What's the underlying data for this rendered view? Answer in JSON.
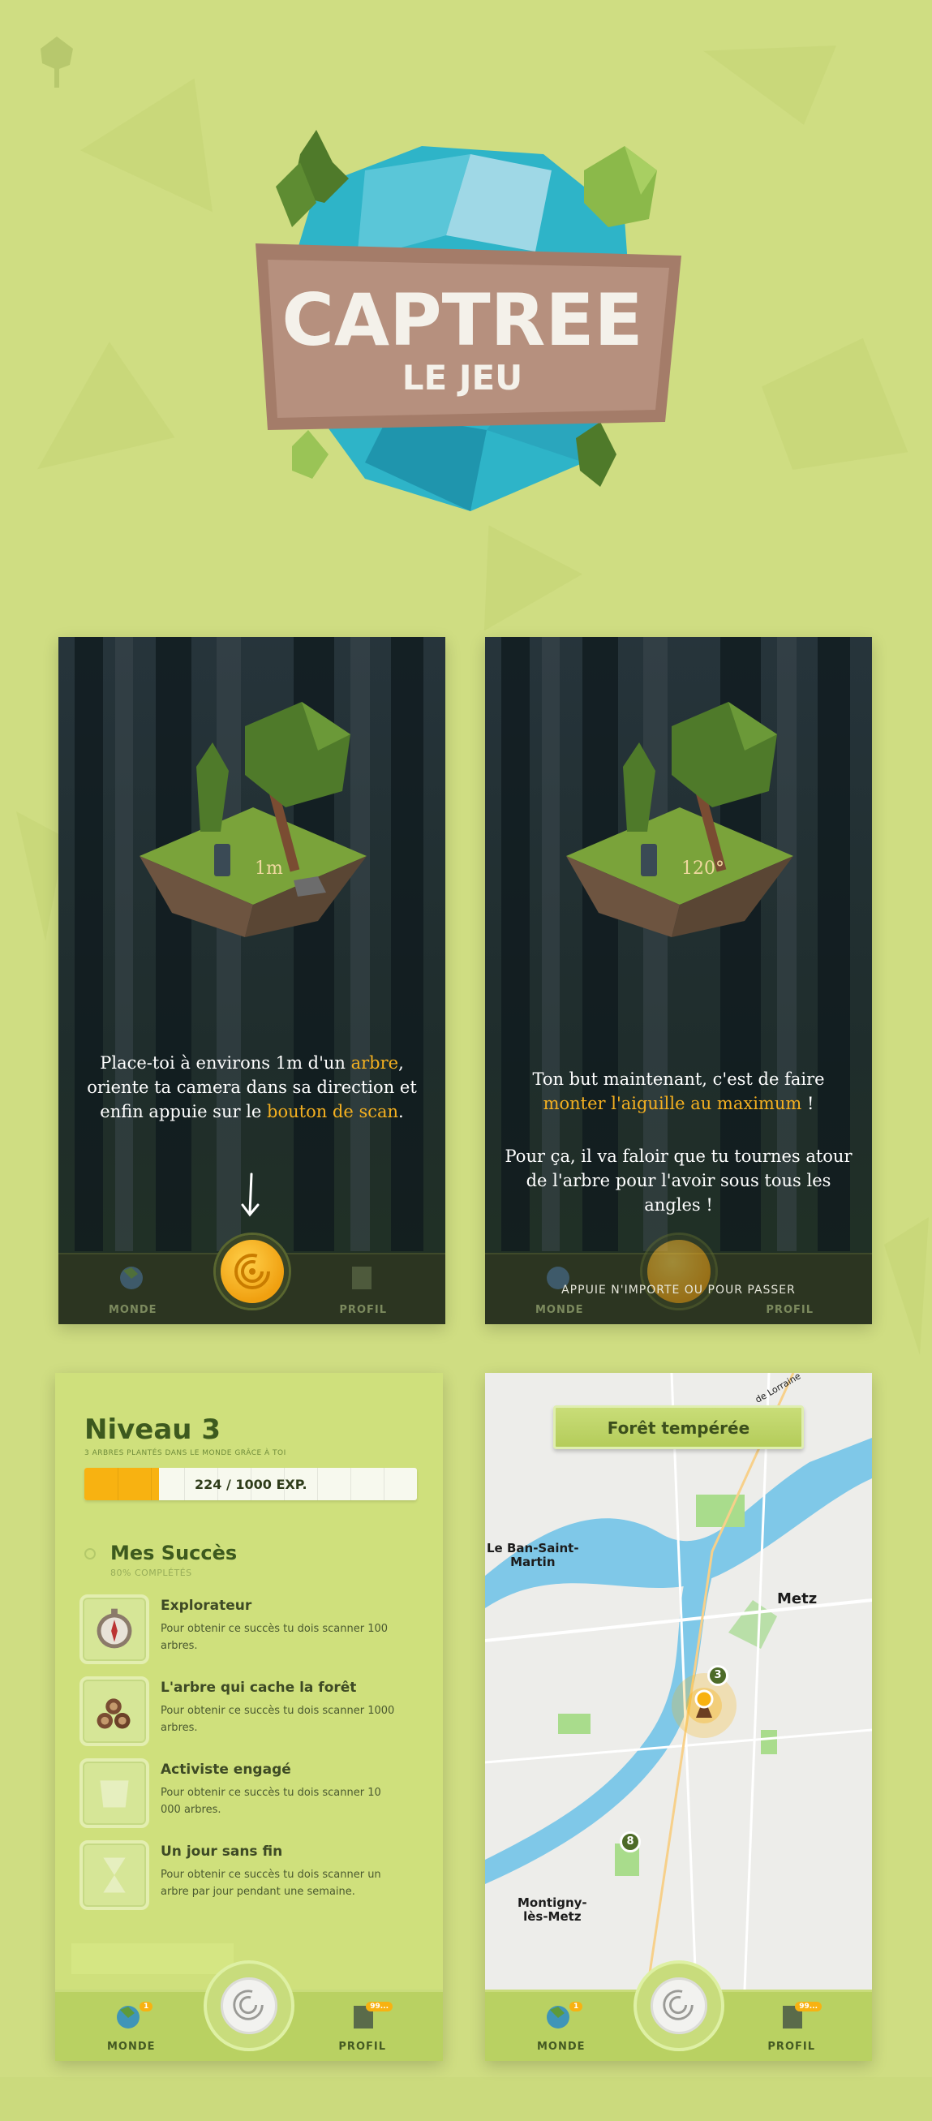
{
  "logo": {
    "title": "CAPTREE",
    "subtitle": "LE JEU"
  },
  "tutorial_1": {
    "text_before": "Place-toi à environs 1m d'un ",
    "text_highlight_1": "arbre",
    "text_middle": ", oriente ta camera dans sa direction et enfin appuie sur le ",
    "text_highlight_2": "bouton de scan",
    "text_end": ".",
    "sign_label": "1m",
    "nav_left": "MONDE",
    "nav_right": "PROFIL"
  },
  "tutorial_2": {
    "text_before": "Ton but maintenant, c'est de faire ",
    "text_highlight": "monter l'aiguille au maximum",
    "text_end": " !",
    "text_second": "Pour ça, il va faloir que tu tournes atour de l'arbre pour l'avoir sous tous les angles !",
    "sign_label": "120°",
    "skip_text": "APPUIE N'IMPORTE OU POUR PASSER",
    "nav_left": "MONDE",
    "nav_right": "PROFIL"
  },
  "profile": {
    "level_title": "Niveau 3",
    "level_subtitle": "3 ARBRES PLANTÉS DANS LE MONDE GRÂCE À TOI",
    "xp_text": "224 / 1000 EXP.",
    "xp_progress": 0.224,
    "achievements_title": "Mes Succès",
    "achievements_progress": "80% COMPLÉTÉS",
    "achievements": [
      {
        "title": "Explorateur",
        "desc": "Pour obtenir ce succès tu dois scanner 100 arbres.",
        "icon": "compass-icon",
        "unlocked": true
      },
      {
        "title": "L'arbre qui cache la forêt",
        "desc": "Pour obtenir ce succès tu dois scanner 1000 arbres.",
        "icon": "logs-icon",
        "unlocked": true
      },
      {
        "title": "Activiste engagé",
        "desc": "Pour obtenir ce succès tu dois scanner 10 000 arbres.",
        "icon": "scroll-icon",
        "unlocked": false
      },
      {
        "title": "Un jour sans fin",
        "desc": "Pour obtenir ce succès tu dois scanner un arbre par jour pendant une semaine.",
        "icon": "hourglass-icon",
        "unlocked": false
      }
    ],
    "nav_left": "MONDE",
    "nav_right": "PROFIL",
    "badge_left": "1",
    "badge_right": "99..."
  },
  "map": {
    "banner": "Forêt tempérée",
    "labels": {
      "ban_saint_martin": "Le Ban-Saint-\nMartin",
      "metz": "Metz",
      "montigny": "Montigny-\nlès-Metz",
      "road": "de Lorraine"
    },
    "markers": [
      "3",
      "8"
    ],
    "nav_left": "MONDE",
    "nav_right": "PROFIL",
    "badge_left": "1",
    "badge_right": "99..."
  },
  "colors": {
    "accent": "#f8b211",
    "background": "#cfdd82",
    "dark_green": "#3d5a1e"
  }
}
